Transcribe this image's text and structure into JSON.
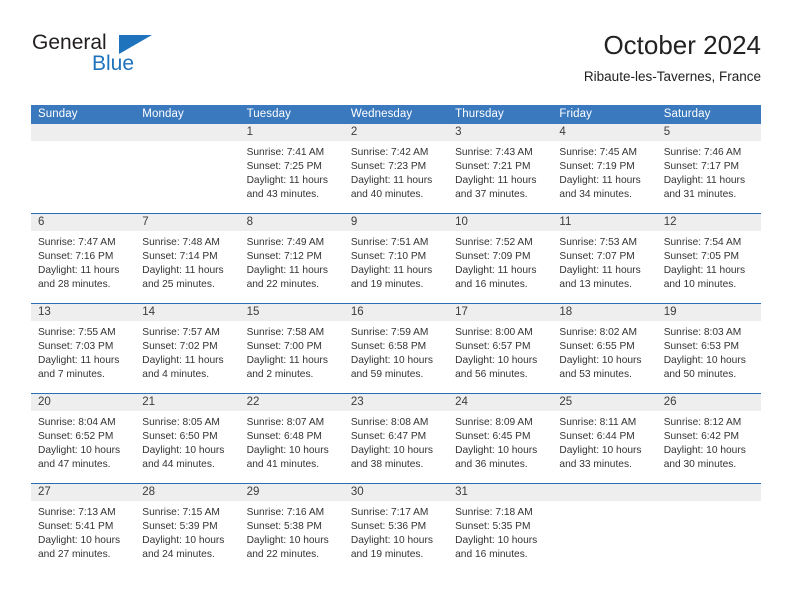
{
  "brand": {
    "name_top": "General",
    "name_bottom": "Blue",
    "triangle_color": "#1f73bd",
    "text_color": "#231f20"
  },
  "header": {
    "title": "October 2024",
    "subtitle": "Ribaute-les-Tavernes, France"
  },
  "theme": {
    "header_blue": "#3a79be",
    "row_border_blue": "#2a6db3",
    "daynum_band": "#eeeeee",
    "text": "#333333"
  },
  "weekdays": [
    "Sunday",
    "Monday",
    "Tuesday",
    "Wednesday",
    "Thursday",
    "Friday",
    "Saturday"
  ],
  "weeks": [
    [
      {
        "day": "",
        "sunrise": "",
        "sunset": "",
        "daylight_1": "",
        "daylight_2": ""
      },
      {
        "day": "",
        "sunrise": "",
        "sunset": "",
        "daylight_1": "",
        "daylight_2": ""
      },
      {
        "day": "1",
        "sunrise": "Sunrise: 7:41 AM",
        "sunset": "Sunset: 7:25 PM",
        "daylight_1": "Daylight: 11 hours",
        "daylight_2": "and 43 minutes."
      },
      {
        "day": "2",
        "sunrise": "Sunrise: 7:42 AM",
        "sunset": "Sunset: 7:23 PM",
        "daylight_1": "Daylight: 11 hours",
        "daylight_2": "and 40 minutes."
      },
      {
        "day": "3",
        "sunrise": "Sunrise: 7:43 AM",
        "sunset": "Sunset: 7:21 PM",
        "daylight_1": "Daylight: 11 hours",
        "daylight_2": "and 37 minutes."
      },
      {
        "day": "4",
        "sunrise": "Sunrise: 7:45 AM",
        "sunset": "Sunset: 7:19 PM",
        "daylight_1": "Daylight: 11 hours",
        "daylight_2": "and 34 minutes."
      },
      {
        "day": "5",
        "sunrise": "Sunrise: 7:46 AM",
        "sunset": "Sunset: 7:17 PM",
        "daylight_1": "Daylight: 11 hours",
        "daylight_2": "and 31 minutes."
      }
    ],
    [
      {
        "day": "6",
        "sunrise": "Sunrise: 7:47 AM",
        "sunset": "Sunset: 7:16 PM",
        "daylight_1": "Daylight: 11 hours",
        "daylight_2": "and 28 minutes."
      },
      {
        "day": "7",
        "sunrise": "Sunrise: 7:48 AM",
        "sunset": "Sunset: 7:14 PM",
        "daylight_1": "Daylight: 11 hours",
        "daylight_2": "and 25 minutes."
      },
      {
        "day": "8",
        "sunrise": "Sunrise: 7:49 AM",
        "sunset": "Sunset: 7:12 PM",
        "daylight_1": "Daylight: 11 hours",
        "daylight_2": "and 22 minutes."
      },
      {
        "day": "9",
        "sunrise": "Sunrise: 7:51 AM",
        "sunset": "Sunset: 7:10 PM",
        "daylight_1": "Daylight: 11 hours",
        "daylight_2": "and 19 minutes."
      },
      {
        "day": "10",
        "sunrise": "Sunrise: 7:52 AM",
        "sunset": "Sunset: 7:09 PM",
        "daylight_1": "Daylight: 11 hours",
        "daylight_2": "and 16 minutes."
      },
      {
        "day": "11",
        "sunrise": "Sunrise: 7:53 AM",
        "sunset": "Sunset: 7:07 PM",
        "daylight_1": "Daylight: 11 hours",
        "daylight_2": "and 13 minutes."
      },
      {
        "day": "12",
        "sunrise": "Sunrise: 7:54 AM",
        "sunset": "Sunset: 7:05 PM",
        "daylight_1": "Daylight: 11 hours",
        "daylight_2": "and 10 minutes."
      }
    ],
    [
      {
        "day": "13",
        "sunrise": "Sunrise: 7:55 AM",
        "sunset": "Sunset: 7:03 PM",
        "daylight_1": "Daylight: 11 hours",
        "daylight_2": "and 7 minutes."
      },
      {
        "day": "14",
        "sunrise": "Sunrise: 7:57 AM",
        "sunset": "Sunset: 7:02 PM",
        "daylight_1": "Daylight: 11 hours",
        "daylight_2": "and 4 minutes."
      },
      {
        "day": "15",
        "sunrise": "Sunrise: 7:58 AM",
        "sunset": "Sunset: 7:00 PM",
        "daylight_1": "Daylight: 11 hours",
        "daylight_2": "and 2 minutes."
      },
      {
        "day": "16",
        "sunrise": "Sunrise: 7:59 AM",
        "sunset": "Sunset: 6:58 PM",
        "daylight_1": "Daylight: 10 hours",
        "daylight_2": "and 59 minutes."
      },
      {
        "day": "17",
        "sunrise": "Sunrise: 8:00 AM",
        "sunset": "Sunset: 6:57 PM",
        "daylight_1": "Daylight: 10 hours",
        "daylight_2": "and 56 minutes."
      },
      {
        "day": "18",
        "sunrise": "Sunrise: 8:02 AM",
        "sunset": "Sunset: 6:55 PM",
        "daylight_1": "Daylight: 10 hours",
        "daylight_2": "and 53 minutes."
      },
      {
        "day": "19",
        "sunrise": "Sunrise: 8:03 AM",
        "sunset": "Sunset: 6:53 PM",
        "daylight_1": "Daylight: 10 hours",
        "daylight_2": "and 50 minutes."
      }
    ],
    [
      {
        "day": "20",
        "sunrise": "Sunrise: 8:04 AM",
        "sunset": "Sunset: 6:52 PM",
        "daylight_1": "Daylight: 10 hours",
        "daylight_2": "and 47 minutes."
      },
      {
        "day": "21",
        "sunrise": "Sunrise: 8:05 AM",
        "sunset": "Sunset: 6:50 PM",
        "daylight_1": "Daylight: 10 hours",
        "daylight_2": "and 44 minutes."
      },
      {
        "day": "22",
        "sunrise": "Sunrise: 8:07 AM",
        "sunset": "Sunset: 6:48 PM",
        "daylight_1": "Daylight: 10 hours",
        "daylight_2": "and 41 minutes."
      },
      {
        "day": "23",
        "sunrise": "Sunrise: 8:08 AM",
        "sunset": "Sunset: 6:47 PM",
        "daylight_1": "Daylight: 10 hours",
        "daylight_2": "and 38 minutes."
      },
      {
        "day": "24",
        "sunrise": "Sunrise: 8:09 AM",
        "sunset": "Sunset: 6:45 PM",
        "daylight_1": "Daylight: 10 hours",
        "daylight_2": "and 36 minutes."
      },
      {
        "day": "25",
        "sunrise": "Sunrise: 8:11 AM",
        "sunset": "Sunset: 6:44 PM",
        "daylight_1": "Daylight: 10 hours",
        "daylight_2": "and 33 minutes."
      },
      {
        "day": "26",
        "sunrise": "Sunrise: 8:12 AM",
        "sunset": "Sunset: 6:42 PM",
        "daylight_1": "Daylight: 10 hours",
        "daylight_2": "and 30 minutes."
      }
    ],
    [
      {
        "day": "27",
        "sunrise": "Sunrise: 7:13 AM",
        "sunset": "Sunset: 5:41 PM",
        "daylight_1": "Daylight: 10 hours",
        "daylight_2": "and 27 minutes."
      },
      {
        "day": "28",
        "sunrise": "Sunrise: 7:15 AM",
        "sunset": "Sunset: 5:39 PM",
        "daylight_1": "Daylight: 10 hours",
        "daylight_2": "and 24 minutes."
      },
      {
        "day": "29",
        "sunrise": "Sunrise: 7:16 AM",
        "sunset": "Sunset: 5:38 PM",
        "daylight_1": "Daylight: 10 hours",
        "daylight_2": "and 22 minutes."
      },
      {
        "day": "30",
        "sunrise": "Sunrise: 7:17 AM",
        "sunset": "Sunset: 5:36 PM",
        "daylight_1": "Daylight: 10 hours",
        "daylight_2": "and 19 minutes."
      },
      {
        "day": "31",
        "sunrise": "Sunrise: 7:18 AM",
        "sunset": "Sunset: 5:35 PM",
        "daylight_1": "Daylight: 10 hours",
        "daylight_2": "and 16 minutes."
      },
      {
        "day": "",
        "sunrise": "",
        "sunset": "",
        "daylight_1": "",
        "daylight_2": ""
      },
      {
        "day": "",
        "sunrise": "",
        "sunset": "",
        "daylight_1": "",
        "daylight_2": ""
      }
    ]
  ]
}
